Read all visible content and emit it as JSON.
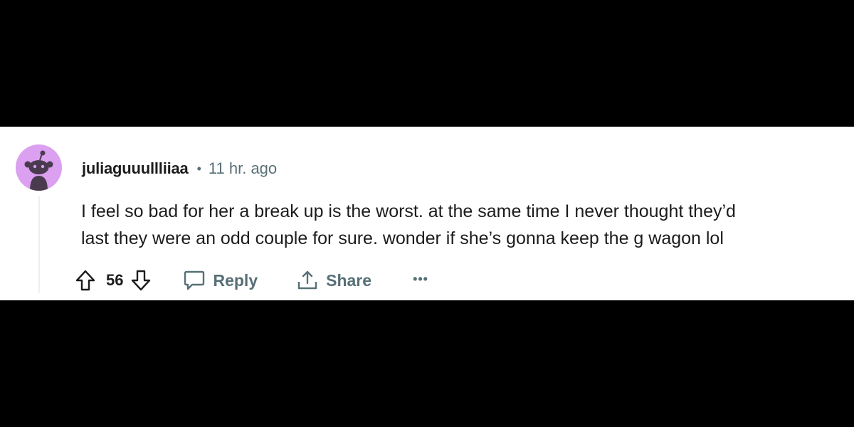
{
  "comment": {
    "username": "juliaguuullliiaa",
    "separator": "•",
    "timestamp": "11 hr. ago",
    "body_lines": [
      "I feel so bad for her a break up is the worst. at the same time I never thought they’d",
      "last they were an odd couple for sure. wonder if she’s gonna keep the g wagon lol"
    ],
    "avatar_color": "#dba0f0",
    "avatar_icon": "snoo-avatar-icon"
  },
  "actions": {
    "upvote_icon": "upvote-arrow-icon",
    "vote_count": "56",
    "downvote_icon": "downvote-arrow-icon",
    "reply_icon": "speech-bubble-icon",
    "reply_label": "Reply",
    "share_icon": "share-icon",
    "share_label": "Share",
    "more_label": "•••",
    "more_icon": "more-options-icon"
  },
  "colors": {
    "text_primary": "#1c1c1c",
    "text_secondary": "#576f76",
    "background_bar": "#000000",
    "card_background": "#ffffff"
  }
}
